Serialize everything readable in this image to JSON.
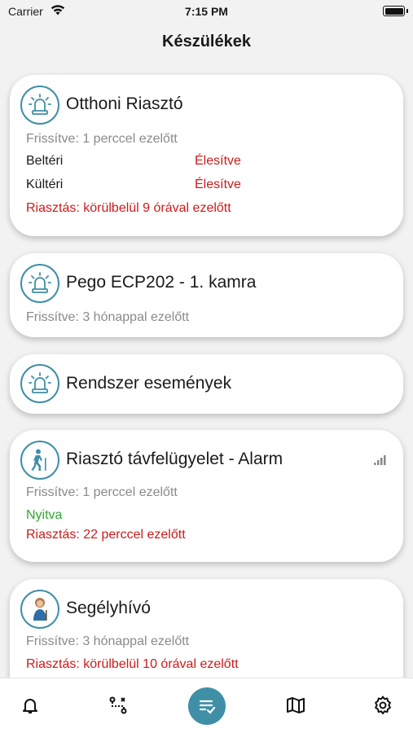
{
  "status_bar": {
    "carrier": "Carrier",
    "time": "7:15 PM"
  },
  "page_title": "Készülékek",
  "colors": {
    "accent": "#3f8fa6",
    "alert_red": "#cc1b1b",
    "ok_green": "#2ea82e",
    "muted": "#8a8a8a"
  },
  "devices": [
    {
      "icon": "alarm-siren-icon",
      "title": "Otthoni Riasztó",
      "updated": "Frissítve: 1 perccel ezelőtt",
      "zones": [
        {
          "name": "Beltéri",
          "state": "Élesítve"
        },
        {
          "name": "Kültéri",
          "state": "Élesítve"
        }
      ],
      "alarm": "Riasztás: körülbelül 9 órával ezelőtt"
    },
    {
      "icon": "alarm-siren-icon",
      "title": "Pego ECP202 - 1. kamra",
      "updated": "Frissítve: 3 hónappal ezelőtt"
    },
    {
      "icon": "alarm-siren-icon",
      "title": "Rendszer események"
    },
    {
      "icon": "walking-person-icon",
      "title": "Riasztó távfelügyelet - Alarm",
      "updated": "Frissítve: 1 perccel ezelőtt",
      "status": "Nyitva",
      "alarm": "Riasztás: 22 perccel ezelőtt",
      "signal_icon": "signal-strength-icon"
    },
    {
      "icon": "elderly-person-icon",
      "title": "Segélyhívó",
      "updated": "Frissítve: 3 hónappal ezelőtt",
      "alarm": "Riasztás: körülbelül 10 órával ezelőtt"
    }
  ],
  "tab_bar": [
    {
      "icon": "bell-icon"
    },
    {
      "icon": "route-icon"
    },
    {
      "icon": "checklist-icon",
      "active": true
    },
    {
      "icon": "map-icon"
    },
    {
      "icon": "gear-icon"
    }
  ]
}
